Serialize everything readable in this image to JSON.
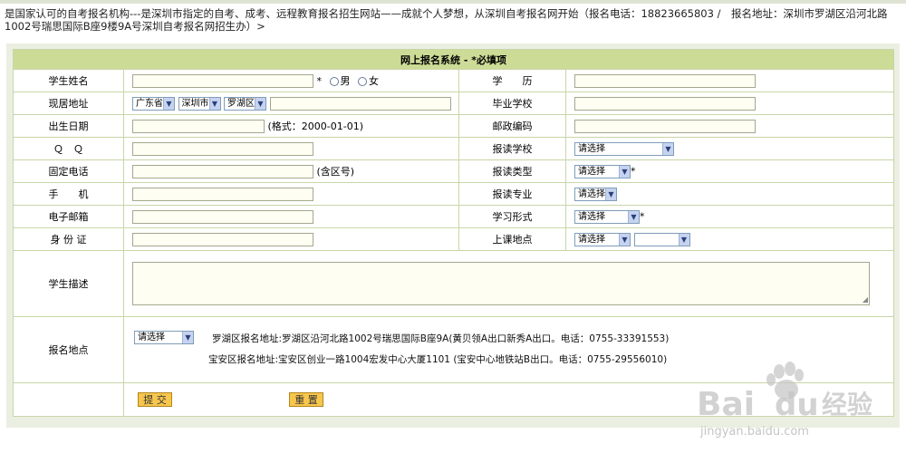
{
  "intro": "是国家认可的自考报名机构---是深圳市指定的自考、成考、远程教育报名招生网站——成就个人梦想，从深圳自考报名网开始（报名电话：18823665803 /　报名地址：深圳市罗湖区沿河北路1002号瑞思国际B座9楼9A号深圳自考报名网招生办）>",
  "form": {
    "title": "网上报名系统 - *必填项",
    "student_name": {
      "label": "学生姓名",
      "value": "",
      "required_mark": "*",
      "male": "男",
      "female": "女"
    },
    "education": {
      "label": "学　　历",
      "value": ""
    },
    "address": {
      "label": "现居地址",
      "province": "广东省",
      "city": "深圳市",
      "district": "罗湖区",
      "value": ""
    },
    "school": {
      "label": "毕业学校",
      "value": ""
    },
    "birth": {
      "label": "出生日期",
      "value": "",
      "hint": "(格式：2000-01-01)"
    },
    "postcode": {
      "label": "邮政编码",
      "value": ""
    },
    "qq": {
      "label": "Ｑ　Ｑ",
      "value": ""
    },
    "apply_school": {
      "label": "报读学校",
      "selected": "请选择"
    },
    "phone": {
      "label": "固定电话",
      "value": "",
      "hint": "(含区号)"
    },
    "apply_type": {
      "label": "报读类型",
      "selected": "请选择",
      "required_mark": "*"
    },
    "mobile": {
      "label": "手　　机",
      "value": ""
    },
    "apply_major": {
      "label": "报读专业",
      "selected": "请选择"
    },
    "email": {
      "label": "电子邮箱",
      "value": ""
    },
    "study_mode": {
      "label": "学习形式",
      "selected": "请选择",
      "required_mark": "*"
    },
    "id_card": {
      "label": "身 份 证",
      "value": ""
    },
    "class_location": {
      "label": "上课地点",
      "selected": "请选择",
      "selected2": ""
    },
    "description": {
      "label": "学生描述",
      "value": ""
    },
    "signup_location": {
      "label": "报名地点",
      "selected": "请选择",
      "address1": "罗湖区报名地址:罗湖区沿河北路1002号瑞思国际B座9A(黄贝领A出口新秀A出口。电话：0755-33391553)",
      "address2": "宝安区报名地址:宝安区创业一路1004宏发中心大厦1101 (宝安中心地铁站B出口。电话：0755-29556010)"
    },
    "submit_label": "提 交",
    "reset_label": "重 置"
  },
  "watermark": {
    "brand": "Bai",
    "brand2": "经验",
    "url": "jingyan.baidu.com"
  },
  "colors": {
    "header_bg": "#ccdc96",
    "border": "#c8d6a8",
    "outer_bg": "#ebefe1",
    "button_bg": "#f7c64d"
  },
  "icons": [
    "dropdown-arrow-icon",
    "radio-icon",
    "paw-logo-icon"
  ]
}
